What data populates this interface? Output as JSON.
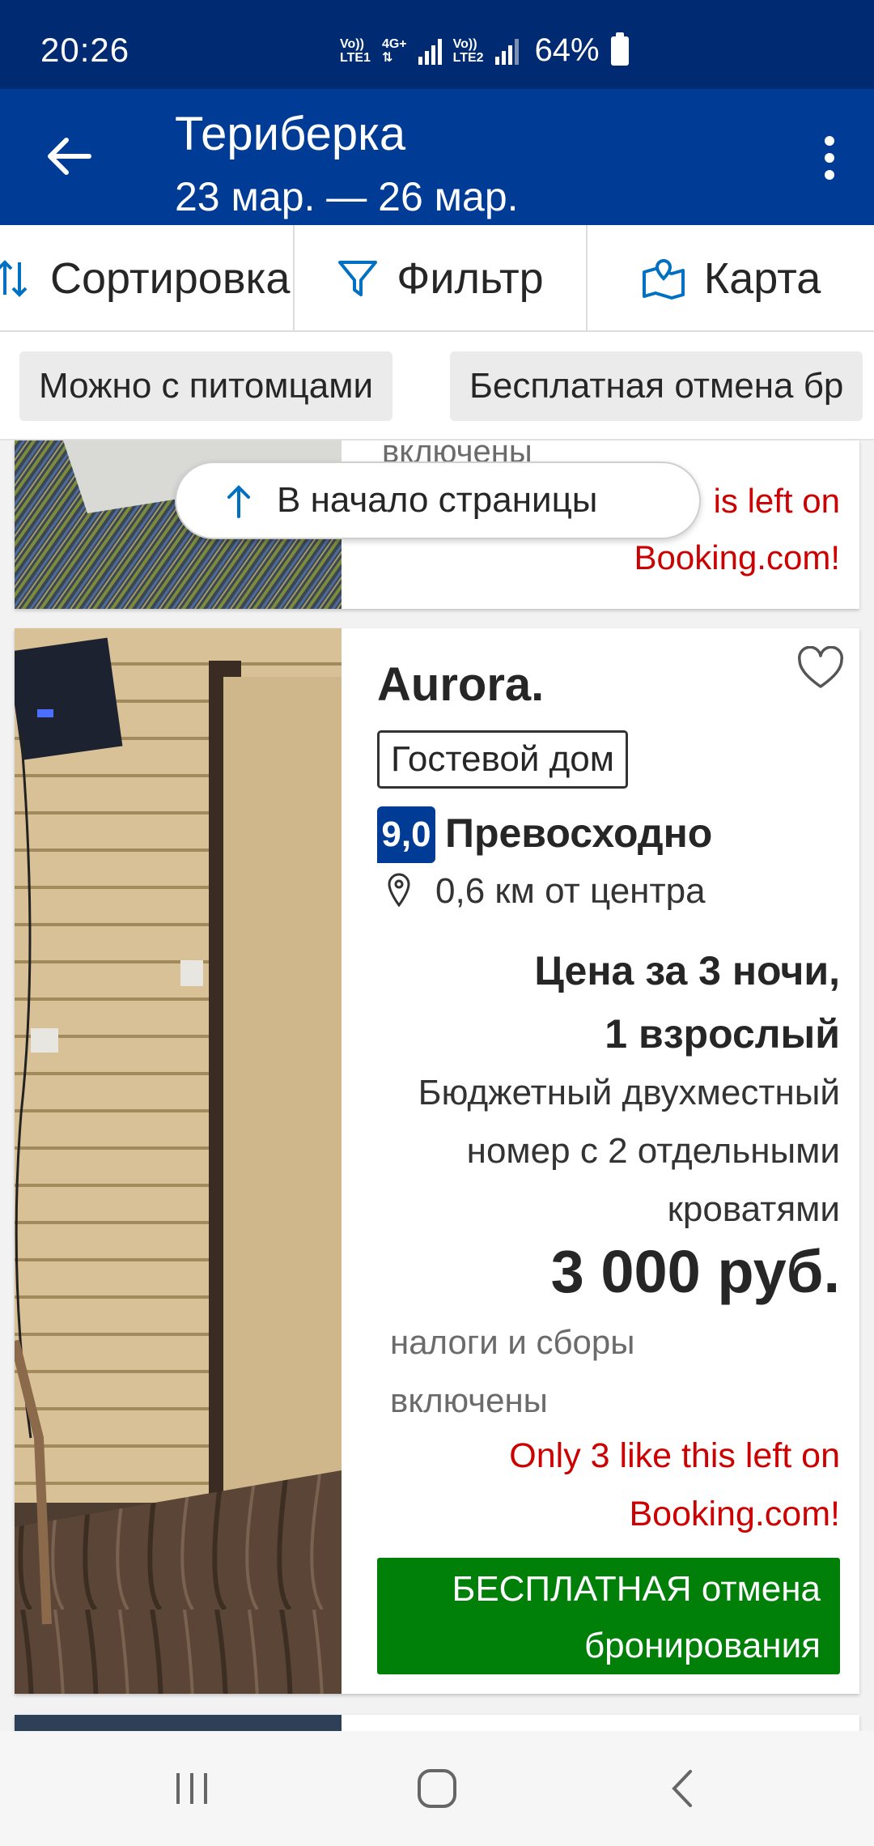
{
  "status_bar": {
    "time": "20:26",
    "sim1": [
      "Vo))",
      "LTE1"
    ],
    "net_type": "4G+",
    "sim2": [
      "Vo))",
      "LTE2"
    ],
    "battery": "64%"
  },
  "header": {
    "title": "Териберка",
    "dates": "23 мар. — 26 мар."
  },
  "toolbar": {
    "sort": "Сортировка",
    "filter": "Фильтр",
    "map": "Карта"
  },
  "chips": [
    "Можно с питомцами",
    "Бесплатная отмена бр"
  ],
  "back_to_top": "В начало страницы",
  "previous_card": {
    "taxes_tail": "включены",
    "availability": [
      "is left on",
      "Booking.com!"
    ]
  },
  "property": {
    "name": "Aurora.",
    "type": "Гостевой дом",
    "score": "9,0",
    "score_label": "Превосходно",
    "distance": "0,6 км от центра",
    "price_for": [
      "Цена за 3 ночи,",
      "1 взрослый"
    ],
    "room": "Бюджетный двухместный номер с 2 отдельными кроватями",
    "price": "3 000 руб.",
    "taxes": "налоги и сборы включены",
    "availability": [
      "Only 3 like this left on",
      "Booking.com!"
    ],
    "free_cancellation": [
      "БЕСПЛАТНАЯ отмена",
      "бронирования"
    ]
  },
  "colors": {
    "brand_dark": "#002b72",
    "brand": "#003b95",
    "green": "#008009",
    "red": "#cc0000"
  }
}
